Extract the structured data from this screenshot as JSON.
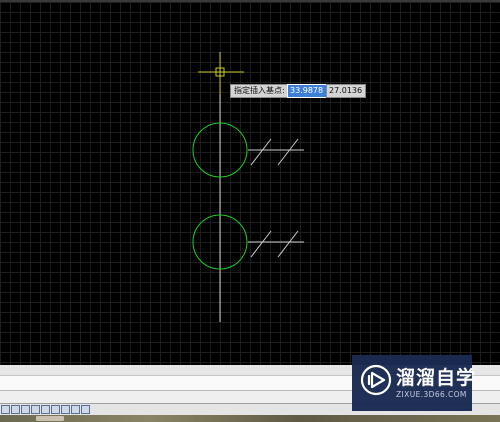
{
  "dynamic_input": {
    "prompt": "指定插入基点:",
    "x_value": "33.9878",
    "y_value": "27.0136"
  },
  "colors": {
    "background": "#000000",
    "grid": "#1d1d1d",
    "circle": "#22cc22",
    "line": "#cfcfcf",
    "crosshair": "#c8c820",
    "x_field_highlight": "#3d7fd6"
  },
  "icons": [
    "crosshair-cursor-icon",
    "osnap-marker-icon",
    "watermark-logo-icon",
    "status-bar-toggle-icon"
  ],
  "watermark": {
    "title": "溜溜自学",
    "url": "ZIXUE.3D66.COM"
  }
}
